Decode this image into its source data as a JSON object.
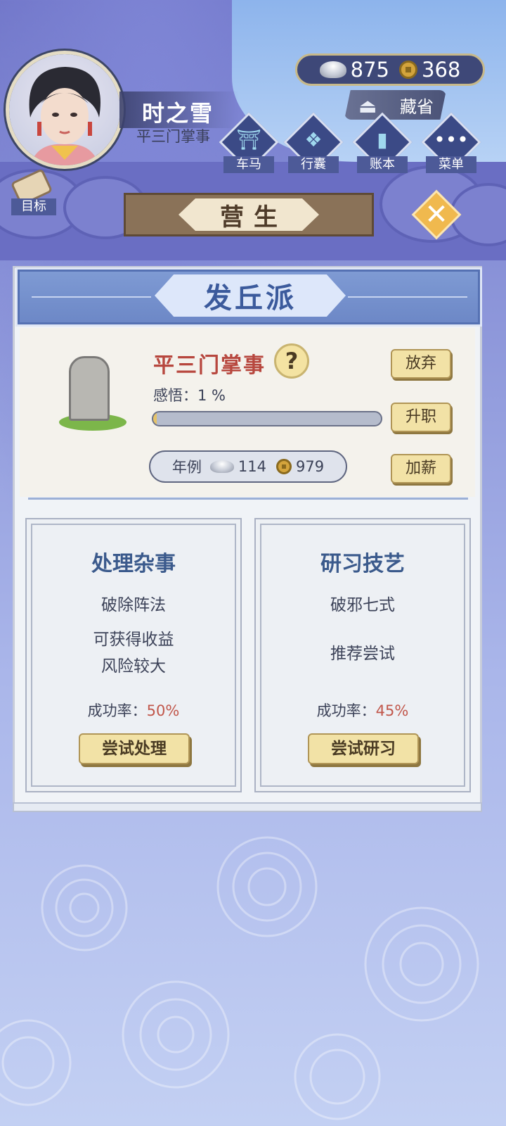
{
  "player": {
    "name": "时之雪",
    "rank": "平三门掌事"
  },
  "currency": {
    "silver": "875",
    "copper": "368"
  },
  "collect_label": "藏省",
  "menu": [
    {
      "label": "车马",
      "icon": "carriage-icon"
    },
    {
      "label": "行囊",
      "icon": "bundle-icon"
    },
    {
      "label": "账本",
      "icon": "ledger-icon"
    },
    {
      "label": "菜单",
      "icon": "more-icon"
    }
  ],
  "goal_label": "目标",
  "screen_title": "营生",
  "section_title": "发丘派",
  "position": {
    "title": "平三门掌事",
    "insight_label": "感悟：1 %",
    "insight_fraction": 0.01,
    "salary_label": "年例",
    "salary_silver": "114",
    "salary_copper": "979"
  },
  "actions": {
    "abandon": "放弃",
    "promote": "升职",
    "raise": "加薪"
  },
  "cards": [
    {
      "title": "处理杂事",
      "sub": "破除阵法",
      "desc": [
        "可获得收益",
        "风险较大"
      ],
      "rate_label": "成功率：",
      "rate": "50%",
      "button": "尝试处理"
    },
    {
      "title": "研习技艺",
      "sub": "破邪七式",
      "desc": [
        "推荐尝试"
      ],
      "rate_label": "成功率：",
      "rate": "45%",
      "button": "尝试研习"
    }
  ]
}
